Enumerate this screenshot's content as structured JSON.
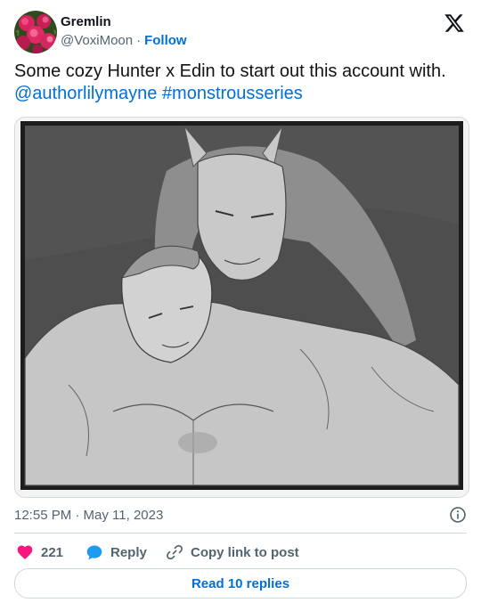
{
  "author": {
    "name": "Gremlin",
    "handle": "@VoxiMoon",
    "separator": "·",
    "follow_label": "Follow"
  },
  "tweet": {
    "text": "Some cozy Hunter x Edin to start out this account with.",
    "mentions": [
      "@authorlilymayne",
      "#monstrousseries"
    ]
  },
  "timestamp": "12:55 PM · May 11, 2023",
  "actions": {
    "like_count": "221",
    "reply_label": "Reply",
    "copy_label": "Copy link to post"
  },
  "read_replies_label": "Read 10 replies",
  "icons": {
    "brand": "x-logo-icon",
    "like": "heart-icon",
    "reply": "speech-bubble-icon",
    "copy": "link-icon",
    "info": "info-icon"
  },
  "colors": {
    "link": "#006fd6",
    "like": "#f91880",
    "reply": "#1d9bf0",
    "secondary_text": "#536471",
    "border": "#cfd9de"
  }
}
